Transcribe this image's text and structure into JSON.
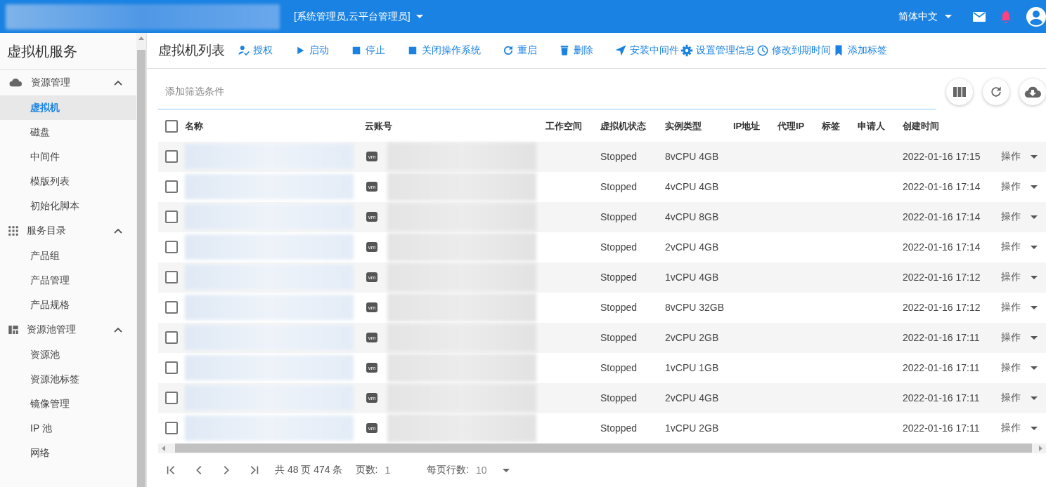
{
  "header": {
    "roles": "[系统管理员,云平台管理员]",
    "language": "简体中文"
  },
  "sidebar": {
    "title": "虚拟机服务",
    "groups": [
      {
        "label": "资源管理",
        "expanded": true,
        "items": [
          {
            "label": "虚拟机",
            "selected": true
          },
          {
            "label": "磁盘",
            "selected": false
          },
          {
            "label": "中间件",
            "selected": false
          },
          {
            "label": "模版列表",
            "selected": false
          },
          {
            "label": "初始化脚本",
            "selected": false
          }
        ]
      },
      {
        "label": "服务目录",
        "expanded": true,
        "items": [
          {
            "label": "产品组",
            "selected": false
          },
          {
            "label": "产品管理",
            "selected": false
          },
          {
            "label": "产品规格",
            "selected": false
          }
        ]
      },
      {
        "label": "资源池管理",
        "expanded": true,
        "items": [
          {
            "label": "资源池",
            "selected": false
          },
          {
            "label": "资源池标签",
            "selected": false
          },
          {
            "label": "镜像管理",
            "selected": false
          },
          {
            "label": "IP 池",
            "selected": false
          },
          {
            "label": "网络",
            "selected": false
          }
        ]
      }
    ]
  },
  "page_title": "虚拟机列表",
  "actions": [
    "授权",
    "启动",
    "停止",
    "关闭操作系统",
    "重启",
    "删除",
    "安装中间件",
    "设置管理信息",
    "修改到期时间",
    "添加标签"
  ],
  "filter": {
    "placeholder": "添加筛选条件"
  },
  "table": {
    "columns": [
      "名称",
      "云账号",
      "工作空间",
      "虚拟机状态",
      "实例类型",
      "IP地址",
      "代理IP",
      "标签",
      "申请人",
      "创建时间"
    ],
    "header_checked": false,
    "rows": [
      {
        "checked": false,
        "badge": "vm",
        "state": "Stopped",
        "type": "8vCPU 4GB",
        "created": "2022-01-16 17:15",
        "action": "操作"
      },
      {
        "checked": false,
        "badge": "vm",
        "state": "Stopped",
        "type": "4vCPU 4GB",
        "created": "2022-01-16 17:14",
        "action": "操作"
      },
      {
        "checked": false,
        "badge": "vm",
        "state": "Stopped",
        "type": "4vCPU 8GB",
        "created": "2022-01-16 17:14",
        "action": "操作"
      },
      {
        "checked": false,
        "badge": "vm",
        "state": "Stopped",
        "type": "2vCPU 4GB",
        "created": "2022-01-16 17:14",
        "action": "操作"
      },
      {
        "checked": false,
        "badge": "vm",
        "state": "Stopped",
        "type": "1vCPU 4GB",
        "created": "2022-01-16 17:12",
        "action": "操作"
      },
      {
        "checked": false,
        "badge": "vm",
        "state": "Stopped",
        "type": "8vCPU 32GB",
        "created": "2022-01-16 17:12",
        "action": "操作"
      },
      {
        "checked": false,
        "badge": "vm",
        "state": "Stopped",
        "type": "2vCPU 2GB",
        "created": "2022-01-16 17:11",
        "action": "操作"
      },
      {
        "checked": false,
        "badge": "vm",
        "state": "Stopped",
        "type": "1vCPU 1GB",
        "created": "2022-01-16 17:11",
        "action": "操作"
      },
      {
        "checked": false,
        "badge": "vm",
        "state": "Stopped",
        "type": "2vCPU 4GB",
        "created": "2022-01-16 17:11",
        "action": "操作"
      },
      {
        "checked": false,
        "badge": "vm",
        "state": "Stopped",
        "type": "1vCPU 2GB",
        "created": "2022-01-16 17:11",
        "action": "操作"
      }
    ]
  },
  "pagination": {
    "summary": "共 48 页 474 条",
    "page_label": "页数:",
    "page": "1",
    "rows_label": "每页行数:",
    "rows_per_page": "10"
  }
}
